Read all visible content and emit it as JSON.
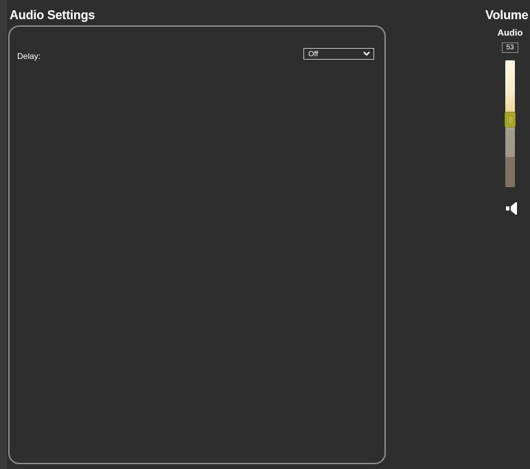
{
  "page": {
    "title": "Audio Settings"
  },
  "settings": {
    "delay_label": "Delay:",
    "delay_value": "Off"
  },
  "volume": {
    "title": "Volume",
    "channel_label": "Audio",
    "value": "53",
    "level_fraction": 0.53,
    "icon": "speaker-icon"
  },
  "colors": {
    "background": "#2e2e2e",
    "panel_border": "#8c8c8c",
    "slider_thumb": "#a6a62a"
  }
}
